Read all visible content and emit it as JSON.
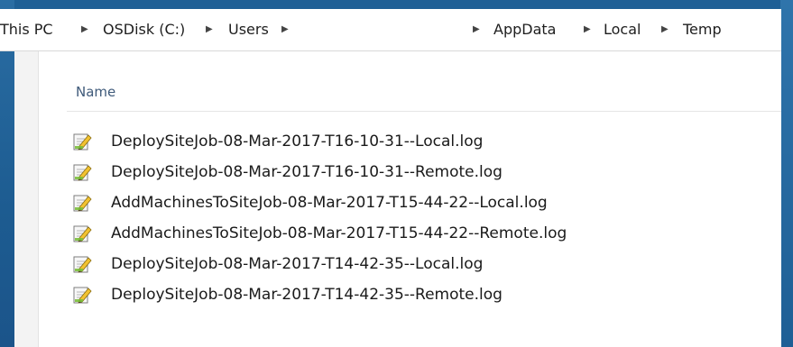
{
  "address_bar": {
    "crumbs": [
      "This PC",
      "OSDisk (C:)",
      "Users",
      "AppData",
      "Local",
      "Temp"
    ]
  },
  "file_list": {
    "column_header": "Name",
    "files": [
      {
        "name": "DeploySiteJob-08-Mar-2017-T16-10-31--Local.log",
        "icon": "log-file-icon"
      },
      {
        "name": "DeploySiteJob-08-Mar-2017-T16-10-31--Remote.log",
        "icon": "log-file-icon"
      },
      {
        "name": "AddMachinesToSiteJob-08-Mar-2017-T15-44-22--Local.log",
        "icon": "log-file-icon"
      },
      {
        "name": "AddMachinesToSiteJob-08-Mar-2017-T15-44-22--Remote.log",
        "icon": "log-file-icon"
      },
      {
        "name": "DeploySiteJob-08-Mar-2017-T14-42-35--Local.log",
        "icon": "log-file-icon"
      },
      {
        "name": "DeploySiteJob-08-Mar-2017-T14-42-35--Remote.log",
        "icon": "log-file-icon"
      }
    ]
  },
  "colors": {
    "desktop_blue": "#1f5c8e",
    "header_text": "#3f5a7a"
  }
}
